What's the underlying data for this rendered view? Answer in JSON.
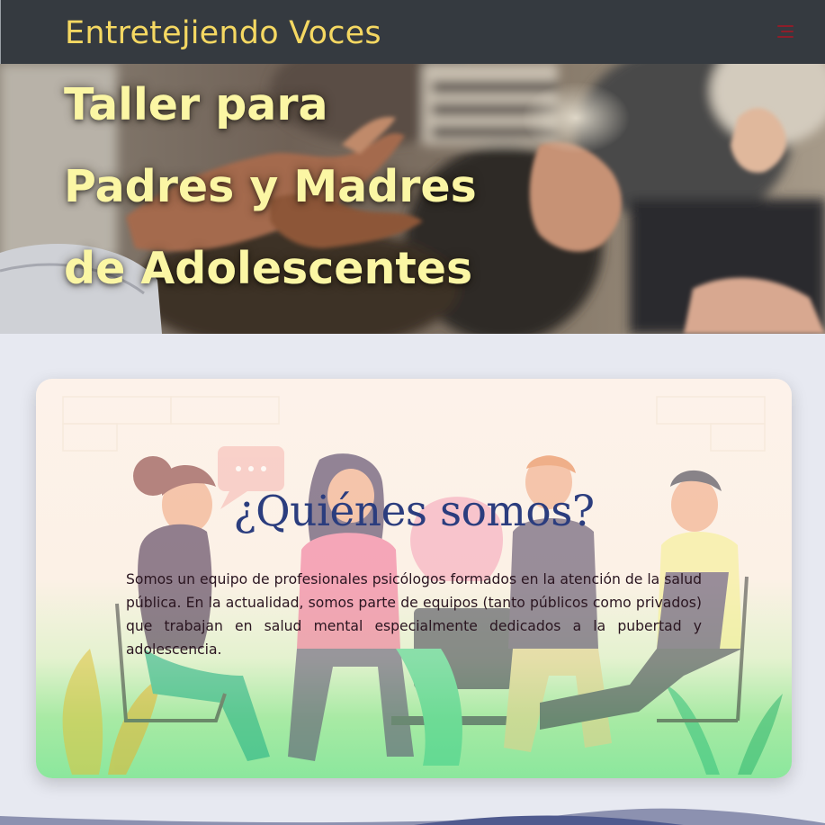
{
  "navbar": {
    "brand": "Entretejiendo Voces",
    "menu_icon": "menu-icon"
  },
  "hero": {
    "title_lines": [
      "Taller para",
      "Padres y Madres",
      "de Adolescentes"
    ],
    "image": "group-therapy-hands-photo"
  },
  "about": {
    "title": "¿Quiénes somos?",
    "text": "Somos un equipo de profesionales psicólogos formados en la atención de la salud pública. En la actualidad, somos parte de equipos (tanto públicos como privados) que trabajan en salud mental especialmente dedicados a la pubertad y adolescencia.",
    "illustration": "group-conversation-illustration"
  },
  "colors": {
    "navbar_bg": "#353a40",
    "brand": "#f5d862",
    "hero_title": "#fbf6a4",
    "section_title": "#2b3d7e",
    "menu_icon": "#8e1e2a"
  }
}
